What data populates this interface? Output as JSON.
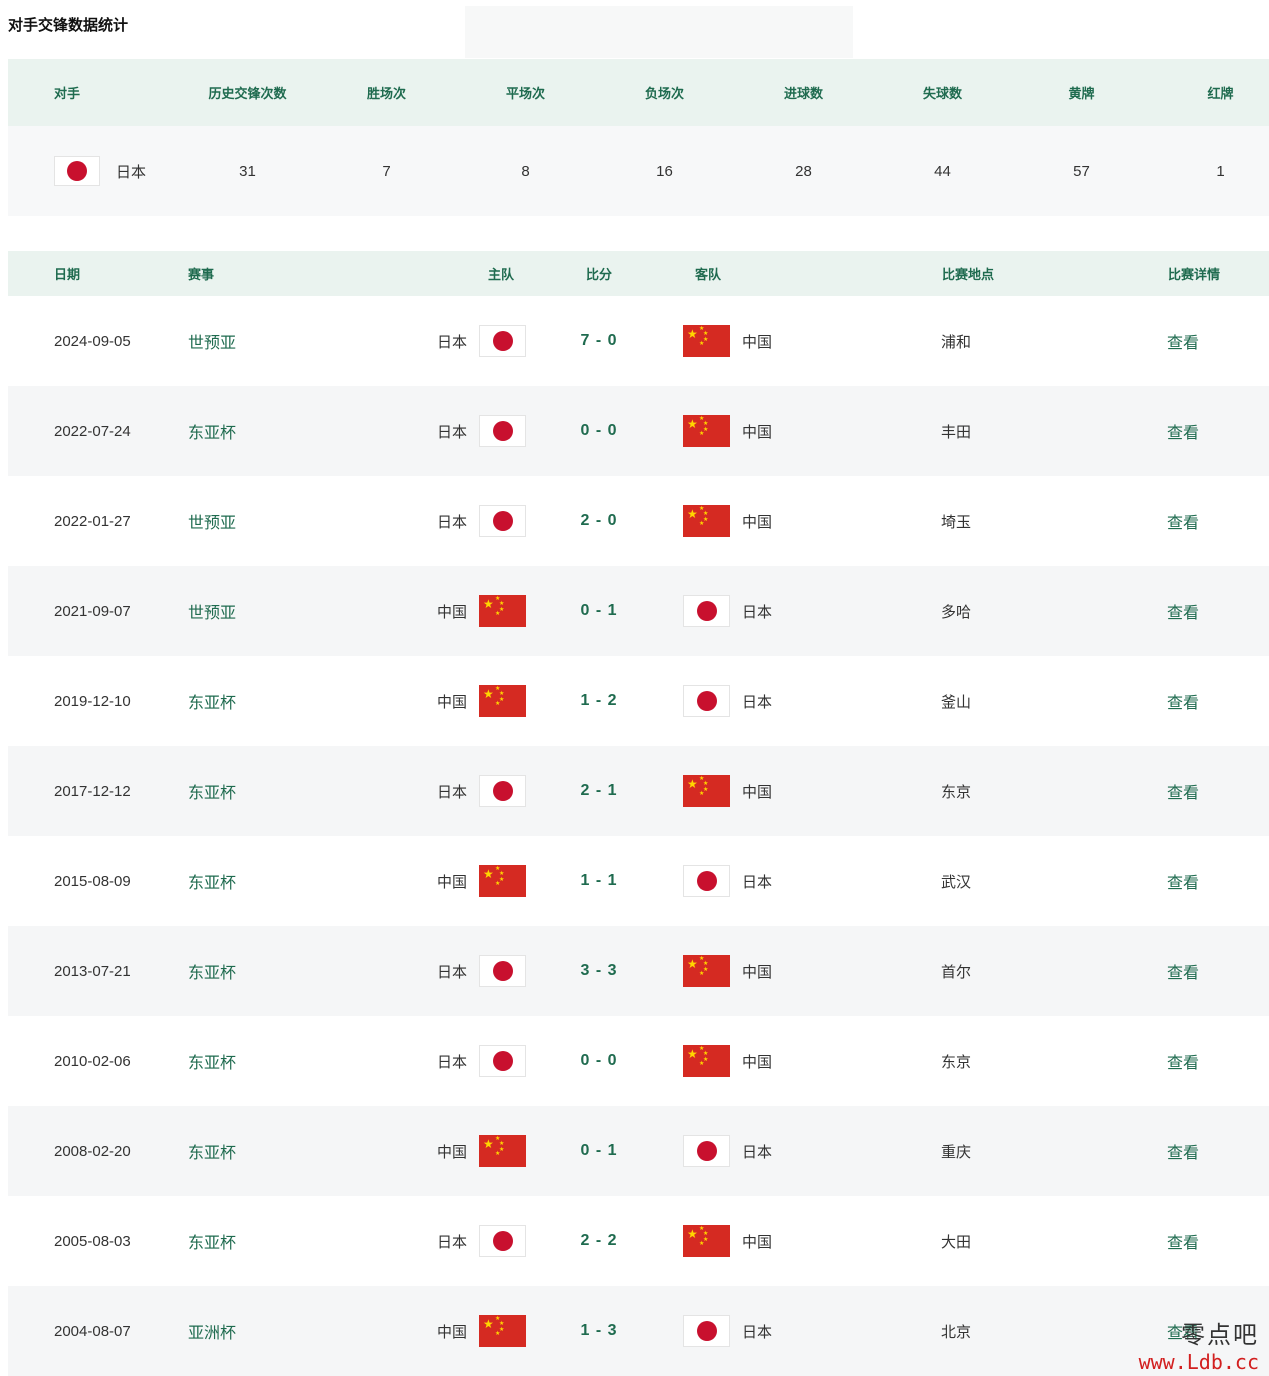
{
  "page_title": "对手交锋数据统计",
  "colors": {
    "accent_green": "#1f6b4f",
    "header_bg": "#eaf3ef",
    "china_red": "#d52a22",
    "japan_red": "#c8102e"
  },
  "summary": {
    "headers": [
      "对手",
      "历史交锋次数",
      "胜场次",
      "平场次",
      "负场次",
      "进球数",
      "失球数",
      "黄牌",
      "红牌"
    ],
    "opponent": {
      "name": "日本",
      "flag": "japan-flag-icon"
    },
    "values": [
      "31",
      "7",
      "8",
      "16",
      "28",
      "44",
      "57",
      "1"
    ]
  },
  "matches": {
    "headers": {
      "date": "日期",
      "competition": "赛事",
      "home": "主队",
      "score": "比分",
      "away": "客队",
      "venue": "比赛地点",
      "detail": "比赛详情"
    },
    "rows": [
      {
        "date": "2024-09-05",
        "competition": "世预亚",
        "home": "日本",
        "home_flag": "jp",
        "score": "7 - 0",
        "away": "中国",
        "away_flag": "cn",
        "venue": "浦和",
        "detail": "查看"
      },
      {
        "date": "2022-07-24",
        "competition": "东亚杯",
        "home": "日本",
        "home_flag": "jp",
        "score": "0 - 0",
        "away": "中国",
        "away_flag": "cn",
        "venue": "丰田",
        "detail": "查看"
      },
      {
        "date": "2022-01-27",
        "competition": "世预亚",
        "home": "日本",
        "home_flag": "jp",
        "score": "2 - 0",
        "away": "中国",
        "away_flag": "cn",
        "venue": "埼玉",
        "detail": "查看"
      },
      {
        "date": "2021-09-07",
        "competition": "世预亚",
        "home": "中国",
        "home_flag": "cn",
        "score": "0 - 1",
        "away": "日本",
        "away_flag": "jp",
        "venue": "多哈",
        "detail": "查看"
      },
      {
        "date": "2019-12-10",
        "competition": "东亚杯",
        "home": "中国",
        "home_flag": "cn",
        "score": "1 - 2",
        "away": "日本",
        "away_flag": "jp",
        "venue": "釜山",
        "detail": "查看"
      },
      {
        "date": "2017-12-12",
        "competition": "东亚杯",
        "home": "日本",
        "home_flag": "jp",
        "score": "2 - 1",
        "away": "中国",
        "away_flag": "cn",
        "venue": "东京",
        "detail": "查看"
      },
      {
        "date": "2015-08-09",
        "competition": "东亚杯",
        "home": "中国",
        "home_flag": "cn",
        "score": "1 - 1",
        "away": "日本",
        "away_flag": "jp",
        "venue": "武汉",
        "detail": "查看"
      },
      {
        "date": "2013-07-21",
        "competition": "东亚杯",
        "home": "日本",
        "home_flag": "jp",
        "score": "3 - 3",
        "away": "中国",
        "away_flag": "cn",
        "venue": "首尔",
        "detail": "查看"
      },
      {
        "date": "2010-02-06",
        "competition": "东亚杯",
        "home": "日本",
        "home_flag": "jp",
        "score": "0 - 0",
        "away": "中国",
        "away_flag": "cn",
        "venue": "东京",
        "detail": "查看"
      },
      {
        "date": "2008-02-20",
        "competition": "东亚杯",
        "home": "中国",
        "home_flag": "cn",
        "score": "0 - 1",
        "away": "日本",
        "away_flag": "jp",
        "venue": "重庆",
        "detail": "查看"
      },
      {
        "date": "2005-08-03",
        "competition": "东亚杯",
        "home": "日本",
        "home_flag": "jp",
        "score": "2 - 2",
        "away": "中国",
        "away_flag": "cn",
        "venue": "大田",
        "detail": "查看"
      },
      {
        "date": "2004-08-07",
        "competition": "亚洲杯",
        "home": "中国",
        "home_flag": "cn",
        "score": "1 - 3",
        "away": "日本",
        "away_flag": "jp",
        "venue": "北京",
        "detail": "查看"
      }
    ]
  },
  "watermark": {
    "text": "零点吧",
    "url": "www.Ldb.cc"
  }
}
